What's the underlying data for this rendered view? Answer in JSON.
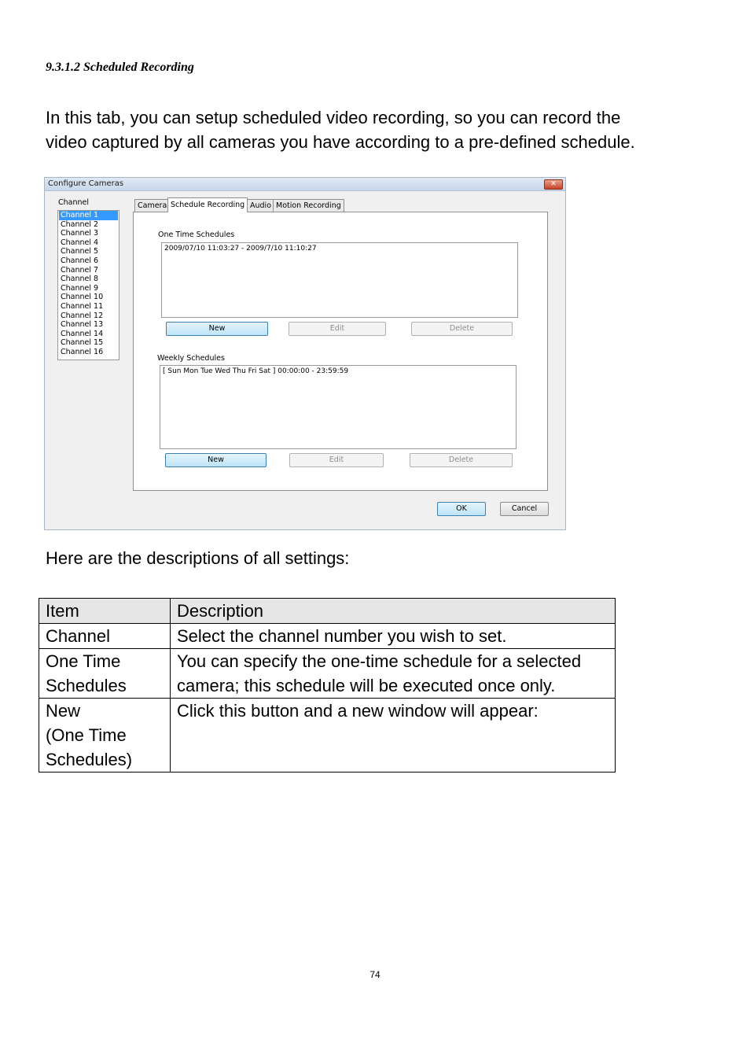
{
  "section_heading": "9.3.1.2 Scheduled Recording",
  "intro_lines": [
    "In this tab, you can setup scheduled video recording, so you can record the",
    "video captured by all cameras you have according to a pre-defined schedule."
  ],
  "dialog": {
    "title": "Configure Cameras",
    "close_glyph": "✕",
    "channel_label": "Channel",
    "channels": [
      "Channel 1",
      "Channel 2",
      "Channel 3",
      "Channel 4",
      "Channel 5",
      "Channel 6",
      "Channel 7",
      "Channel 8",
      "Channel 9",
      "Channel 10",
      "Channel 11",
      "Channel 12",
      "Channel 13",
      "Channel 14",
      "Channel 15",
      "Channel 16"
    ],
    "selected_channel": "Channel 1",
    "tabs": [
      "Camera",
      "Schedule Recording",
      "Audio",
      "Motion Recording"
    ],
    "active_tab": "Schedule Recording",
    "one_time": {
      "label": "One Time Schedules",
      "entries": [
        "2009/07/10 11:03:27 - 2009/7/10 11:10:27"
      ],
      "new_label": "New",
      "edit_label": "Edit",
      "delete_label": "Delete"
    },
    "weekly": {
      "label": "Weekly Schedules",
      "entries": [
        "[ Sun Mon Tue Wed Thu Fri Sat ] 00:00:00 - 23:59:59"
      ],
      "new_label": "New",
      "edit_label": "Edit",
      "delete_label": "Delete"
    },
    "ok_label": "OK",
    "cancel_label": "Cancel"
  },
  "descriptions_intro": "Here are the descriptions of all settings:",
  "table": {
    "header": {
      "item": "Item",
      "description": "Description"
    },
    "rows": [
      {
        "item": "Channel",
        "description": "Select the channel number you wish to set."
      },
      {
        "item": "One Time\nSchedules",
        "description": "You can specify the one-time schedule for a selected camera; this schedule will be executed once only."
      },
      {
        "item": "New\n(One Time\nSchedules)",
        "description": "Click this button and a new window will appear:"
      }
    ]
  },
  "page_number": "74"
}
